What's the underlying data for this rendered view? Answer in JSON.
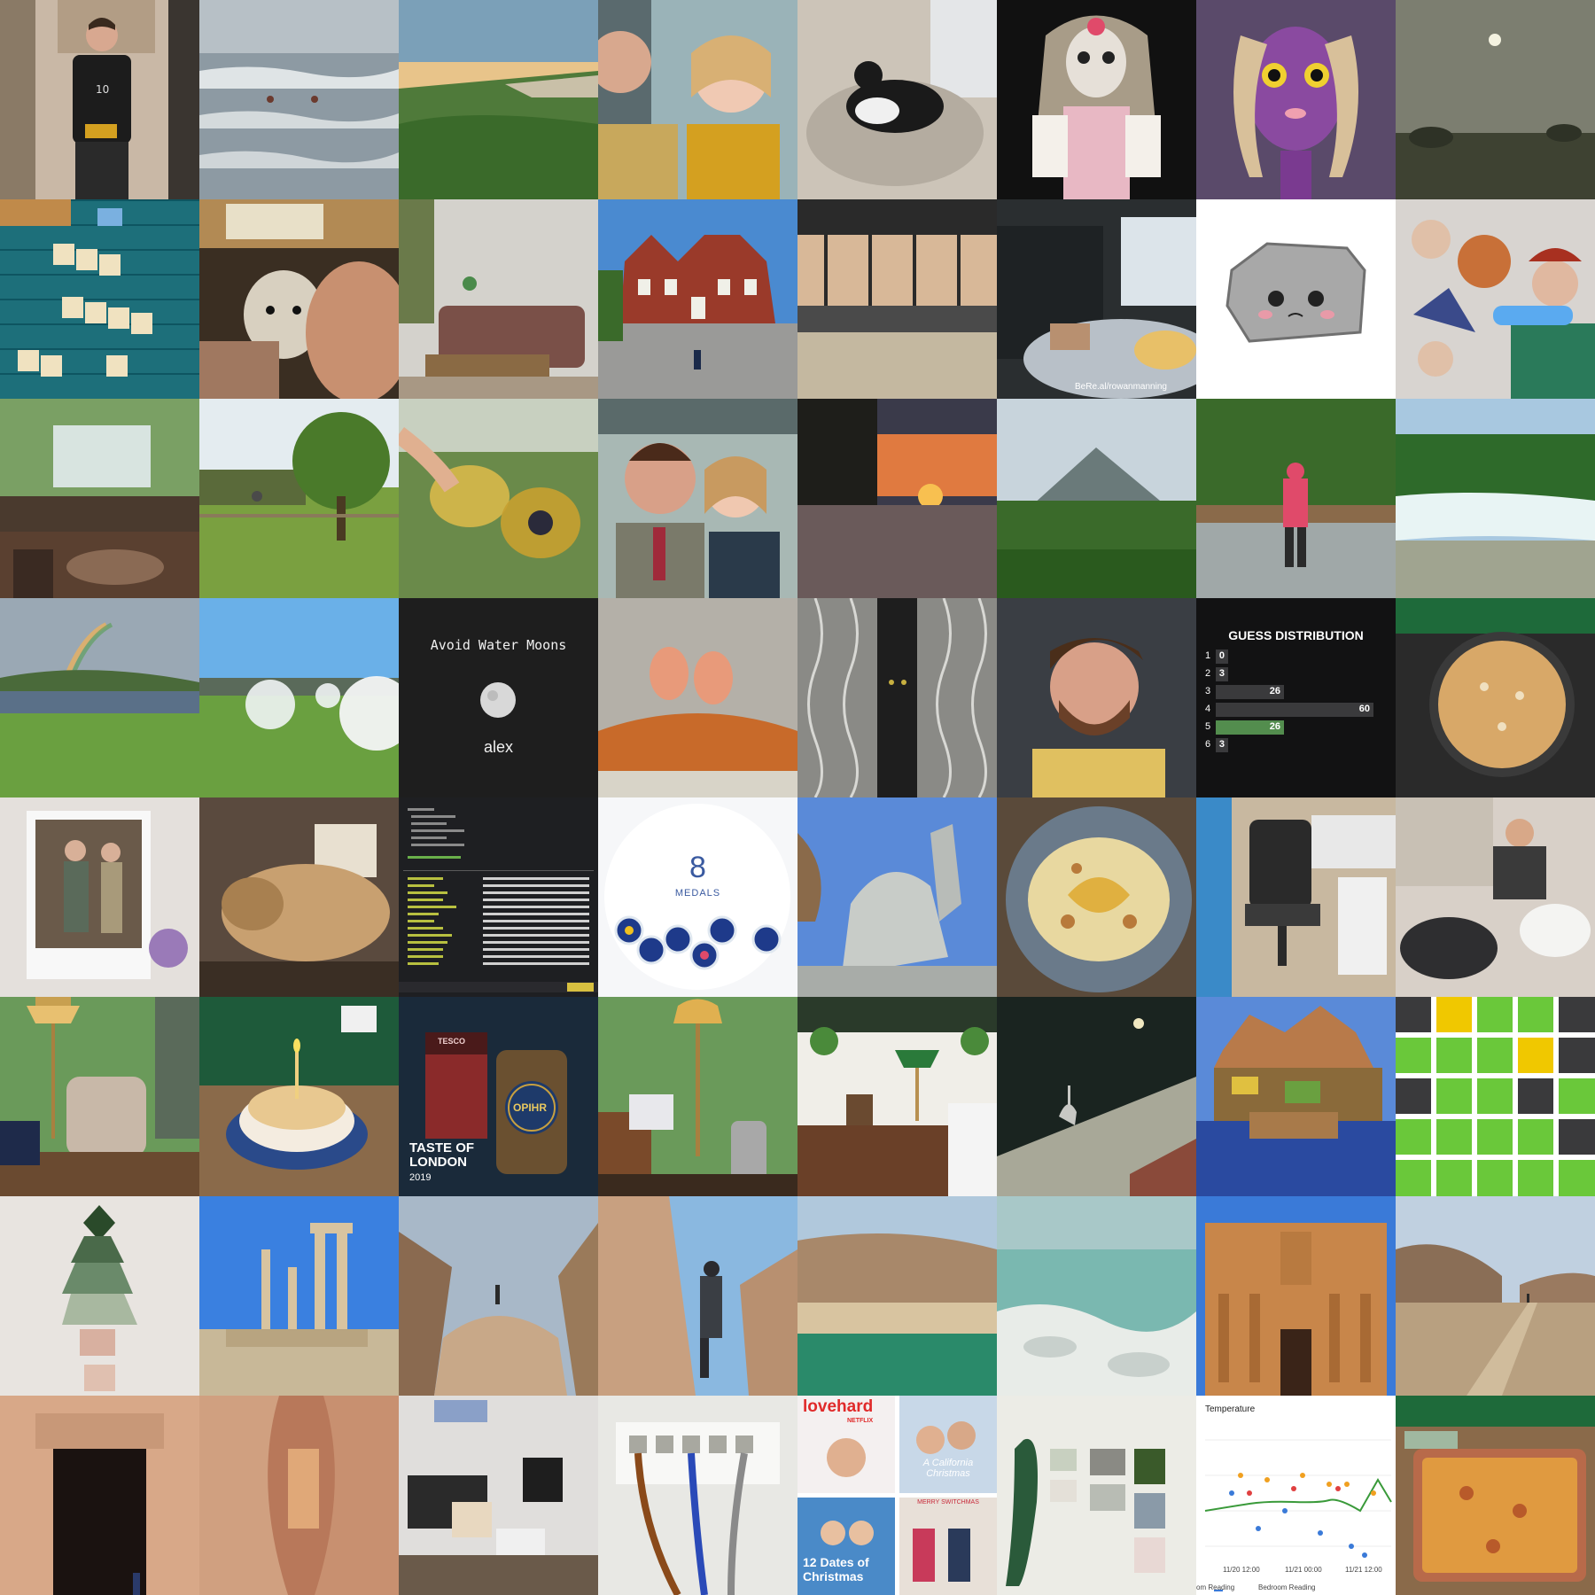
{
  "gallery": {
    "tiles": [
      {
        "row": 1,
        "col": 1,
        "name": "tile-man-t-shirt"
      },
      {
        "row": 1,
        "col": 2,
        "name": "tile-sea-waves-swimmers"
      },
      {
        "row": 1,
        "col": 3,
        "name": "tile-coastal-sunset"
      },
      {
        "row": 1,
        "col": 4,
        "name": "tile-couple-selfie"
      },
      {
        "row": 1,
        "col": 5,
        "name": "tile-cat-on-cushion"
      },
      {
        "row": 1,
        "col": 6,
        "name": "tile-porcelain-doll"
      },
      {
        "row": 1,
        "col": 7,
        "name": "tile-purple-creature-illustration"
      },
      {
        "row": 1,
        "col": 8,
        "name": "tile-misty-field"
      }
    ],
    "rocket_caption": "BeRe.al/rowanmanning",
    "avoid_water_moons": {
      "title": "Avoid Water Moons",
      "user": "alex"
    },
    "guess_distribution": {
      "title": "GUESS DISTRIBUTION",
      "rows": [
        {
          "label": "1",
          "value": 0
        },
        {
          "label": "2",
          "value": 3
        },
        {
          "label": "3",
          "value": 26
        },
        {
          "label": "4",
          "value": 60
        },
        {
          "label": "5",
          "value": 26,
          "highlight": true
        },
        {
          "label": "6",
          "value": 3
        }
      ],
      "max": 60,
      "bar_color": "#3a3a3c",
      "highlight_color": "#538d4e"
    },
    "medals": {
      "count": "8",
      "label": "MEDALS"
    },
    "taste_of_london": {
      "line1": "TASTE OF",
      "line2": "LONDON",
      "year": "2019",
      "tin_label": "TESCO",
      "bottle_label": "OPIHR"
    },
    "movie_posters": {
      "loveheard": "lovehard",
      "netflix": "NETFLIX",
      "california": "A California Christmas",
      "twelve_dates": "12 Dates of Christmas",
      "switch": "MERRY SWITCHMAS"
    },
    "temperature_chart": {
      "title": "Temperature",
      "x_ticks": [
        "11/20 12:00",
        "11/21 00:00",
        "11/21 12:00"
      ],
      "legend": [
        "om Reading",
        "Bedroom Reading"
      ]
    }
  },
  "chart_data": {
    "type": "bar",
    "title": "GUESS DISTRIBUTION",
    "categories": [
      "1",
      "2",
      "3",
      "4",
      "5",
      "6"
    ],
    "values": [
      0,
      3,
      26,
      60,
      26,
      3
    ]
  }
}
